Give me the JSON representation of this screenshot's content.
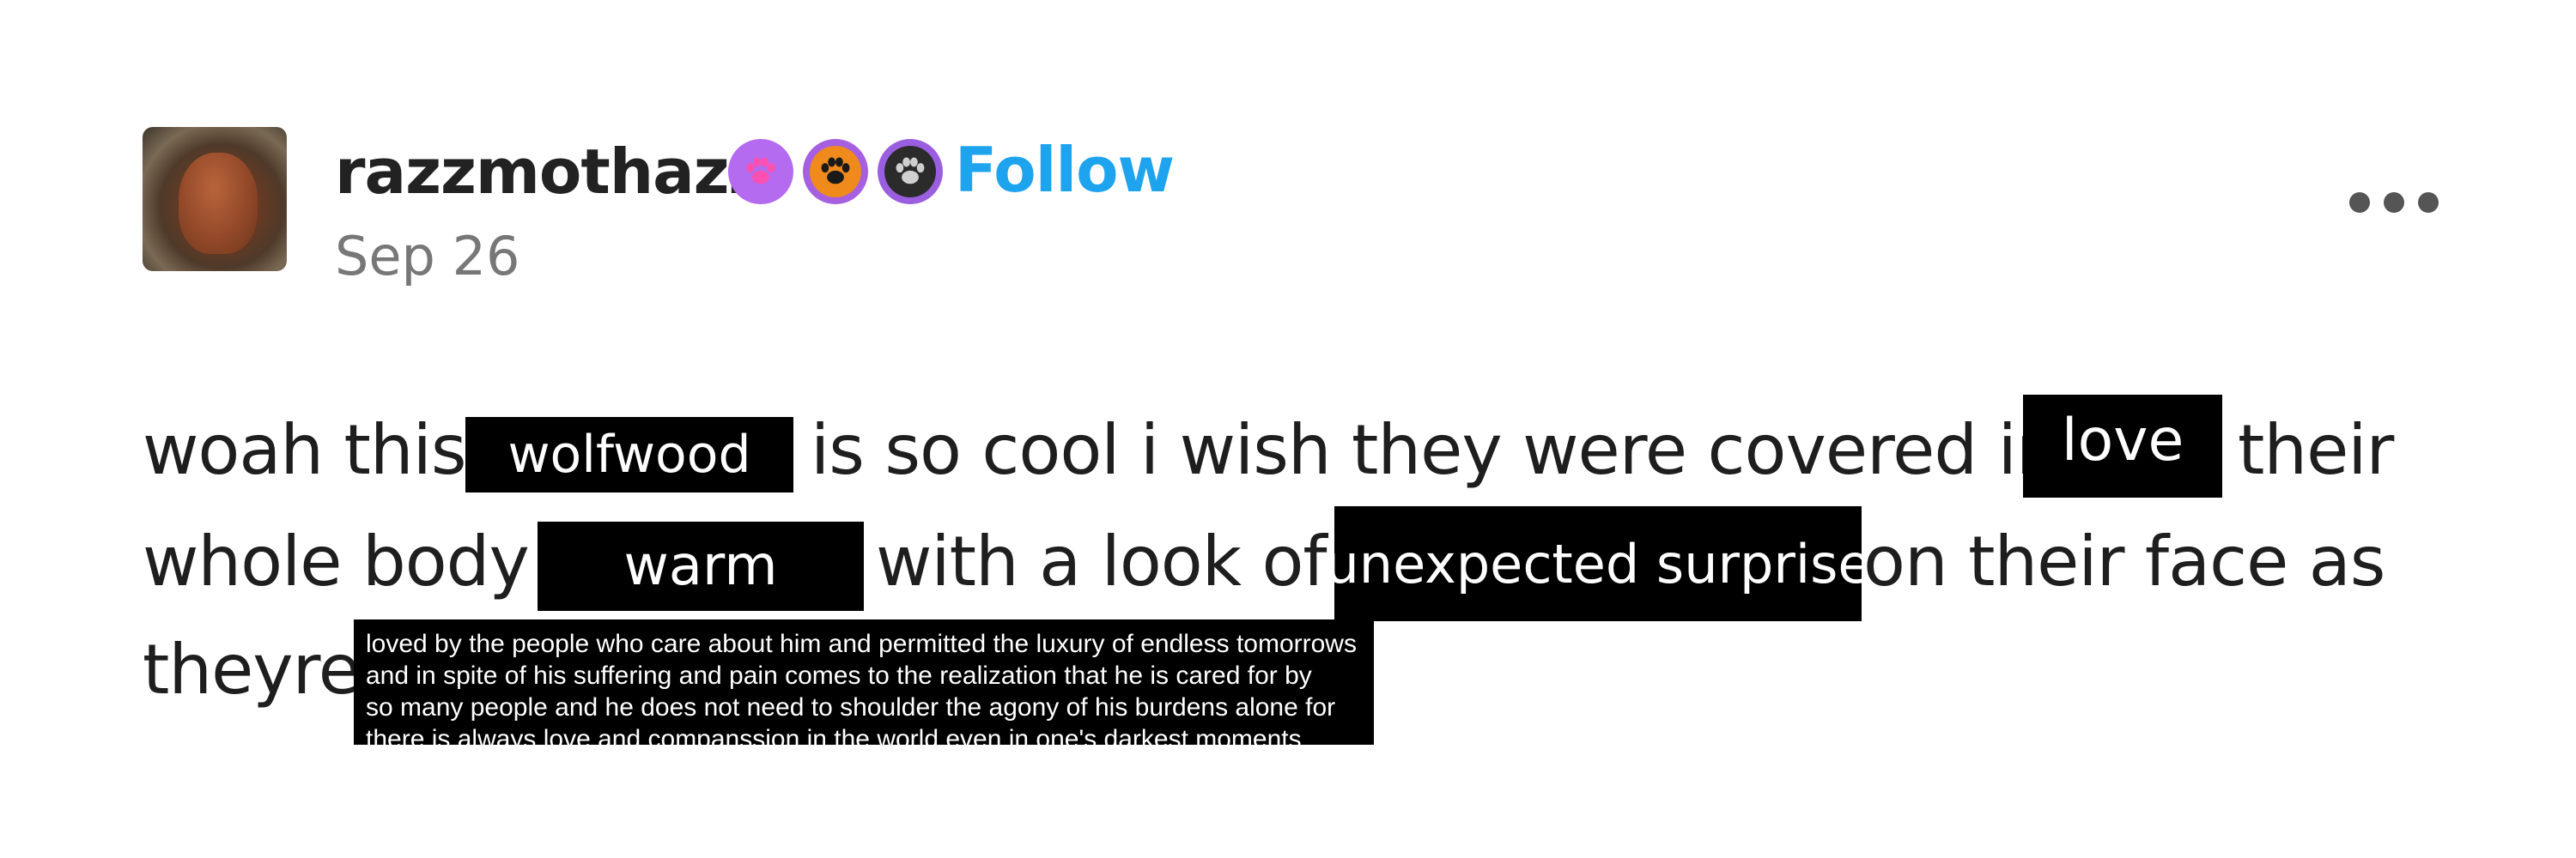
{
  "post": {
    "username": "razzmothazz",
    "follow_label": "Follow",
    "date": "Sep 26",
    "badges": [
      "paw-print-pink",
      "paw-print-orange",
      "paw-print-gray"
    ],
    "more_icon": "more-horizontal-icon"
  },
  "body": {
    "line1_a": "woah this",
    "redact_1": "wolfwood",
    "line1_b": "is so cool i wish they were covered in",
    "redact_2": "love",
    "line1_c": "their",
    "line2_a": "whole body",
    "redact_3": "warm",
    "line2_b": "with a look of",
    "redact_4": "unexpected surprise",
    "line2_c": "on their face as",
    "line3_a": "theyre",
    "note_lines": [
      "loved by the people who care about him and permitted the luxury of endless tomorrows",
      "and in spite of his suffering and pain comes to the realization that he is cared for by",
      "so many people and he does not need to shoulder the agony of his burdens alone for",
      "there is always love and companssion in the world even in one's darkest moments"
    ]
  },
  "colors": {
    "follow": "#1ea4ee",
    "text": "#1e1e1e",
    "date": "#777777",
    "redaction_bg": "#000000"
  }
}
